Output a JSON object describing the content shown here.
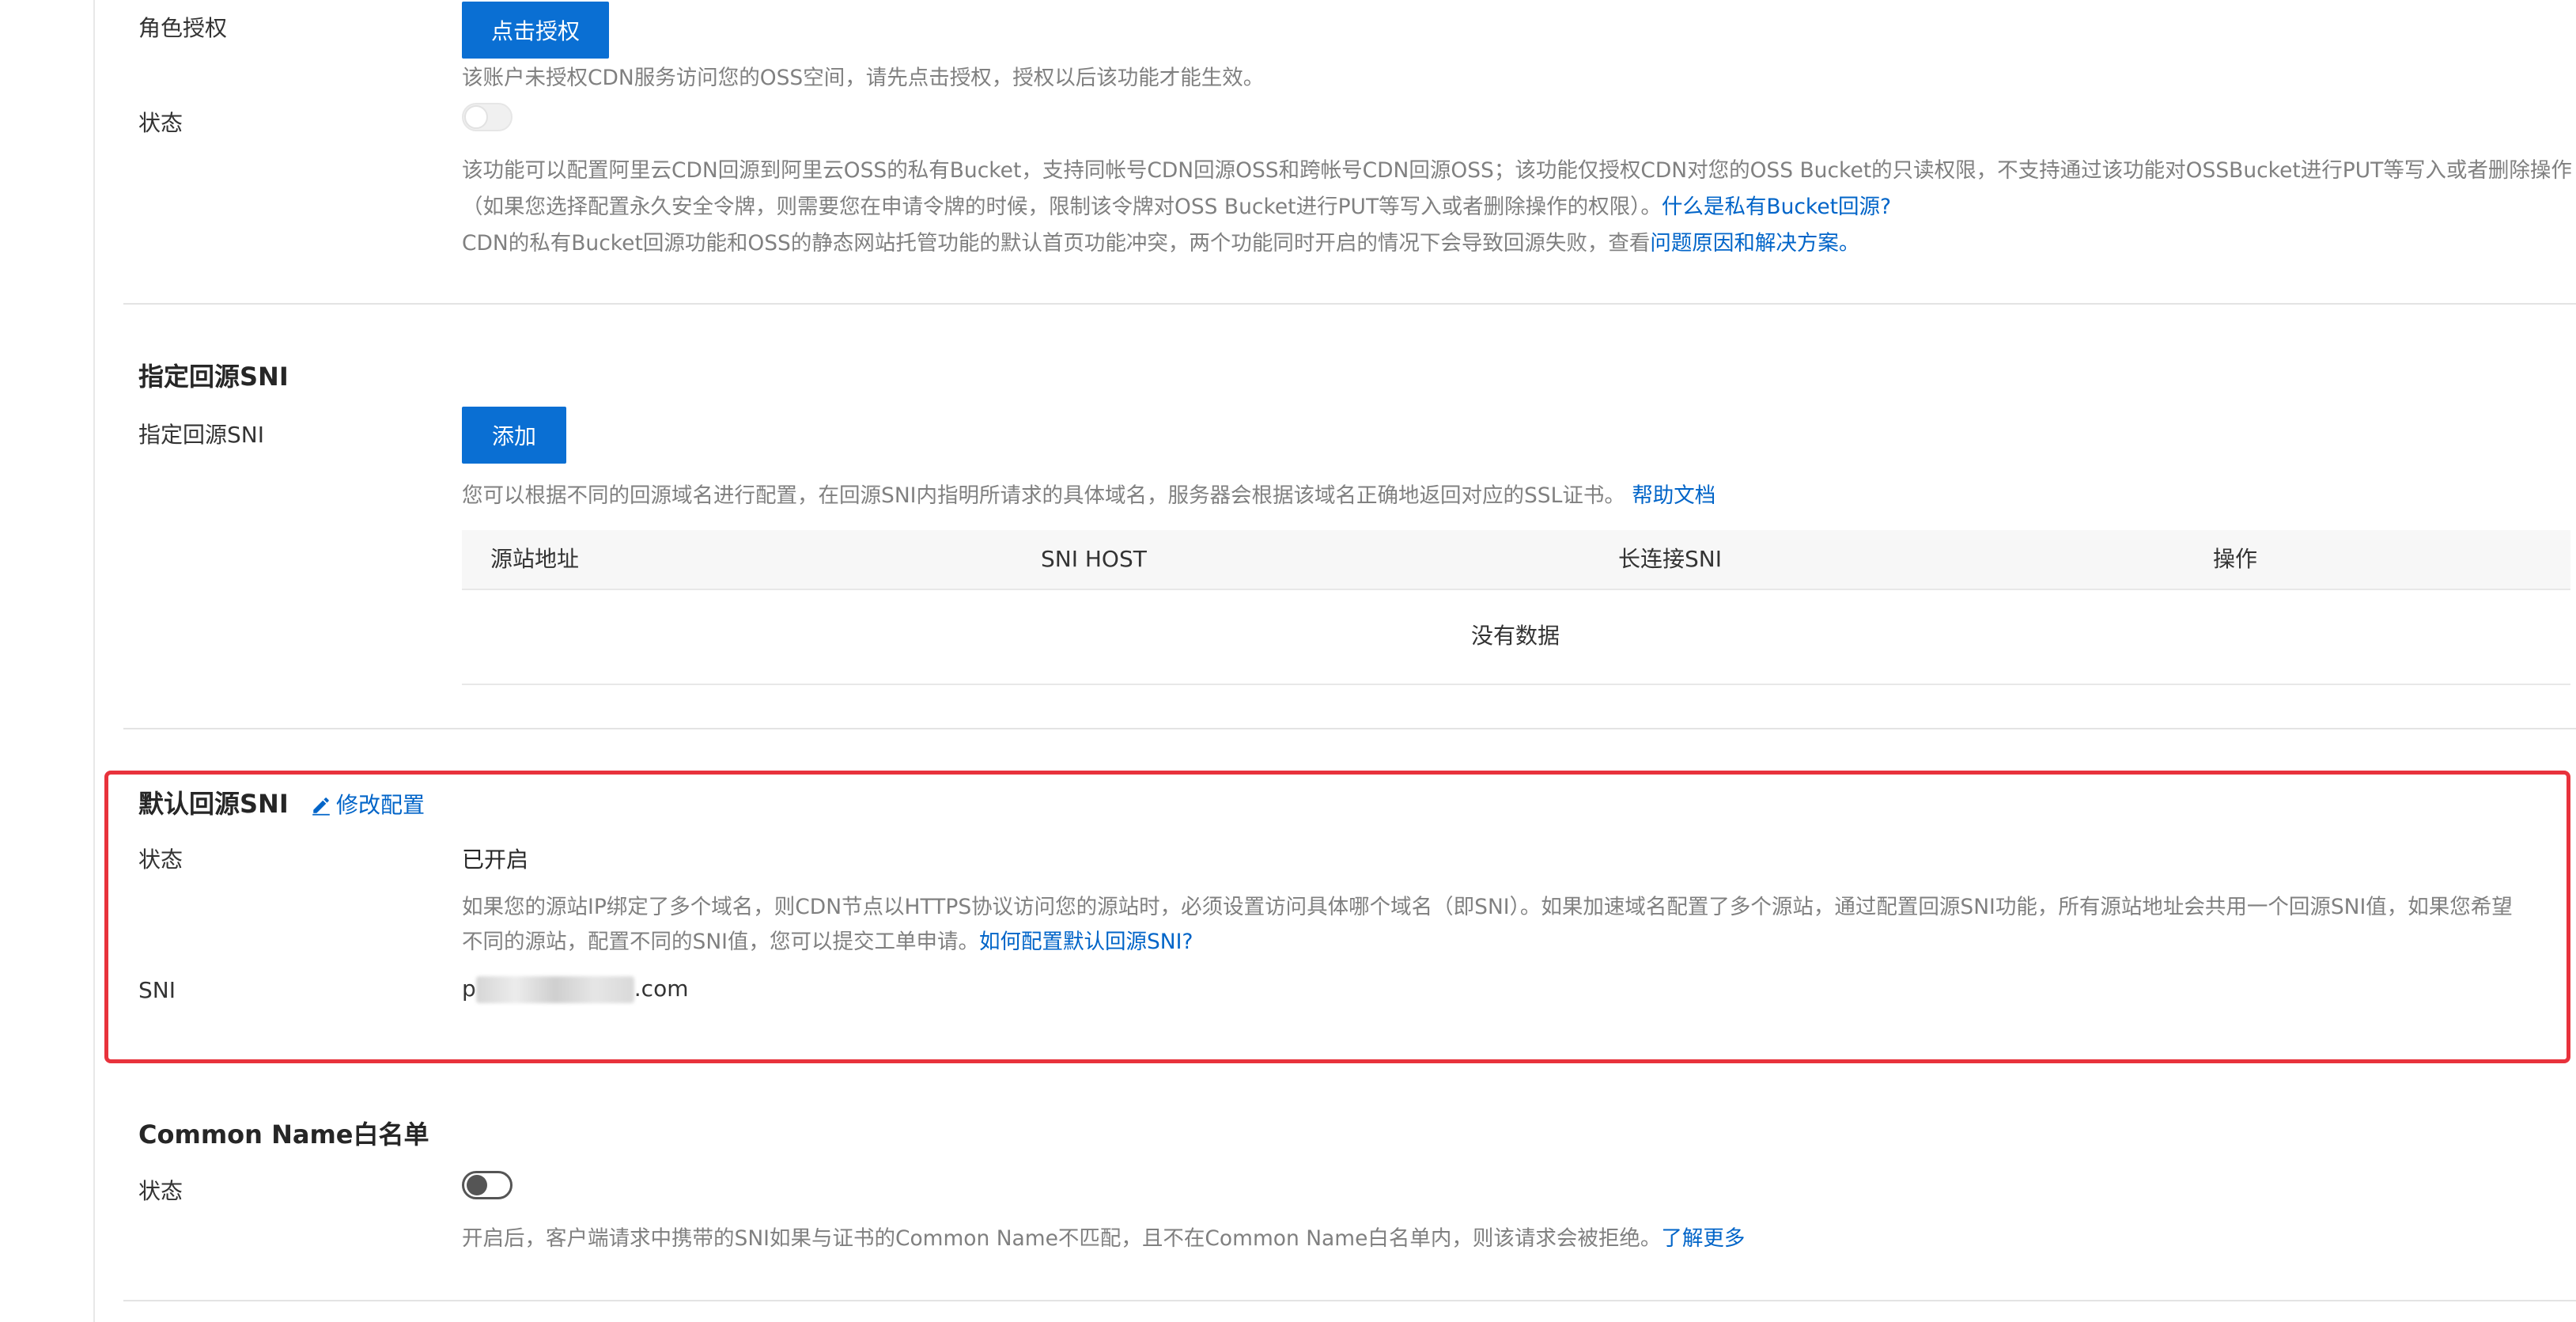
{
  "role_auth": {
    "label": "角色授权",
    "button": "点击授权",
    "hint": "该账户未授权CDN服务访问您的OSS空间，请先点击授权，授权以后该功能才能生效。",
    "status_label": "状态",
    "toggle_state": "disabled",
    "desc_line1": "该功能可以配置阿里云CDN回源到阿里云OSS的私有Bucket，支持同帐号CDN回源OSS和跨帐号CDN回源OSS；该功能仅授权CDN对您的OSS Bucket的只读权限，不支持通过该功能对OSSBucket进行PUT等写入或者删除操作",
    "desc_line2": "（如果您选择配置永久安全令牌，则需要您在申请令牌的时候，限制该令牌对OSS Bucket进行PUT等写入或者删除操作的权限）。",
    "desc_line2_link": "什么是私有Bucket回源?",
    "desc_line3": "CDN的私有Bucket回源功能和OSS的静态网站托管功能的默认首页功能冲突，两个功能同时开启的情况下会导致回源失败，查看",
    "desc_line3_link": "问题原因和解决方案。"
  },
  "specified_sni": {
    "title": "指定回源SNI",
    "label": "指定回源SNI",
    "button": "添加",
    "hint": "您可以根据不同的回源域名进行配置，在回源SNI内指明所请求的具体域名，服务器会根据该域名正确地返回对应的SSL证书。",
    "hint_link": "帮助文档",
    "table": {
      "columns": [
        "源站地址",
        "SNI HOST",
        "长连接SNI",
        "操作"
      ],
      "empty_text": "没有数据"
    }
  },
  "default_sni": {
    "title": "默认回源SNI",
    "edit_link": "修改配置",
    "status_label": "状态",
    "status_value": "已开启",
    "desc_line1": "如果您的源站IP绑定了多个域名，则CDN节点以HTTPS协议访问您的源站时，必须设置访问具体哪个域名（即SNI）。如果加速域名配置了多个源站，通过配置回源SNI功能，所有源站地址会共用一个回源SNI值，如果您希望",
    "desc_line2": "不同的源站，配置不同的SNI值，您可以提交工单申请。",
    "desc_link": "如何配置默认回源SNI?",
    "sni_label": "SNI",
    "sni_prefix": "p",
    "sni_suffix": ".com"
  },
  "common_name": {
    "title": "Common Name白名单",
    "status_label": "状态",
    "toggle_state": "off",
    "desc": "开启后，客户端请求中携带的SNI如果与证书的Common Name不匹配，且不在Common Name白名单内，则该请求会被拒绝。",
    "desc_link": "了解更多"
  },
  "colors": {
    "primary": "#0a6fd3",
    "link": "#0064c8",
    "highlight": "#e8323c"
  }
}
